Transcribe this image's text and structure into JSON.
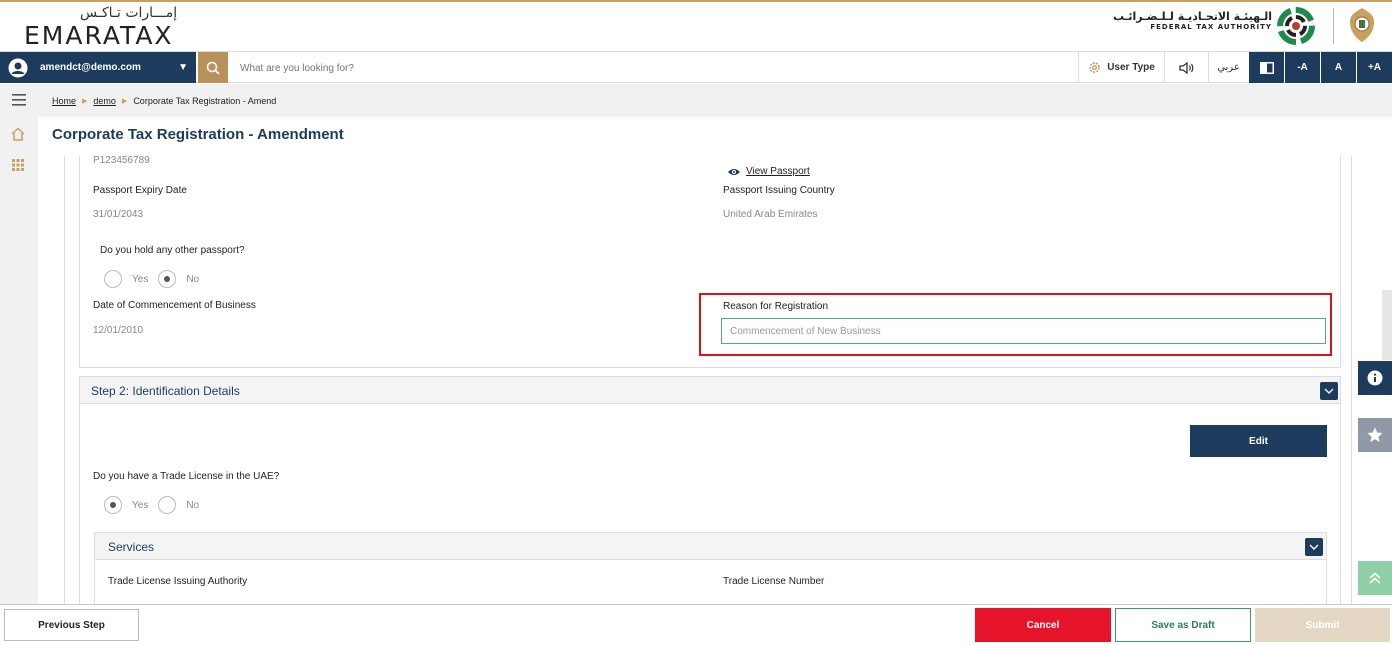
{
  "brand": {
    "logo_arabic": "إمـــارات تـاكـس",
    "logo_english": "EMARATAX",
    "fta_arabic": "الـهيئـة الاتحـاديـة لـلـضـرائـب",
    "fta_english": "FEDERAL TAX AUTHORITY"
  },
  "navbar": {
    "user_email": "amendct@demo.com",
    "search_placeholder": "What are you looking for?",
    "user_type_label": "User Type",
    "language_label": "عربي",
    "font_decrease": "-A",
    "font_reset": "A",
    "font_increase": "+A"
  },
  "breadcrumb": {
    "home": "Home",
    "demo": "demo",
    "current": "Corporate Tax Registration - Amend"
  },
  "page": {
    "title": "Corporate Tax Registration - Amendment"
  },
  "passport": {
    "number": "P123456789",
    "view_link": "View Passport",
    "expiry_label": "Passport Expiry Date",
    "expiry_value": "31/01/2043",
    "issuing_country_label": "Passport Issuing Country",
    "issuing_country_value": "United Arab Emirates",
    "other_passport_question": "Do you hold any other passport?",
    "yes_label": "Yes",
    "no_label": "No",
    "other_passport_selected": "No"
  },
  "business": {
    "commencement_label": "Date of Commencement of Business",
    "commencement_value": "12/01/2010",
    "reason_label": "Reason for Registration",
    "reason_value": "Commencement of New Business"
  },
  "step2": {
    "title": "Step 2: Identification Details",
    "edit_label": "Edit",
    "trade_license_question": "Do you have a Trade License in the UAE?",
    "yes_label": "Yes",
    "no_label": "No",
    "trade_license_selected": "Yes",
    "services_title": "Services",
    "issuing_authority_label": "Trade License Issuing Authority",
    "license_number_label": "Trade License Number"
  },
  "footer": {
    "previous_label": "Previous Step",
    "cancel_label": "Cancel",
    "draft_label": "Save as Draft",
    "submit_label": "Submit"
  },
  "colors": {
    "primary_navy": "#1d3b5c",
    "gold": "#b8925a",
    "cancel_red": "#e5142a",
    "highlight_red": "#d7141a",
    "draft_green": "#2f7d56",
    "scroll_top_green": "#8fcfa8"
  }
}
